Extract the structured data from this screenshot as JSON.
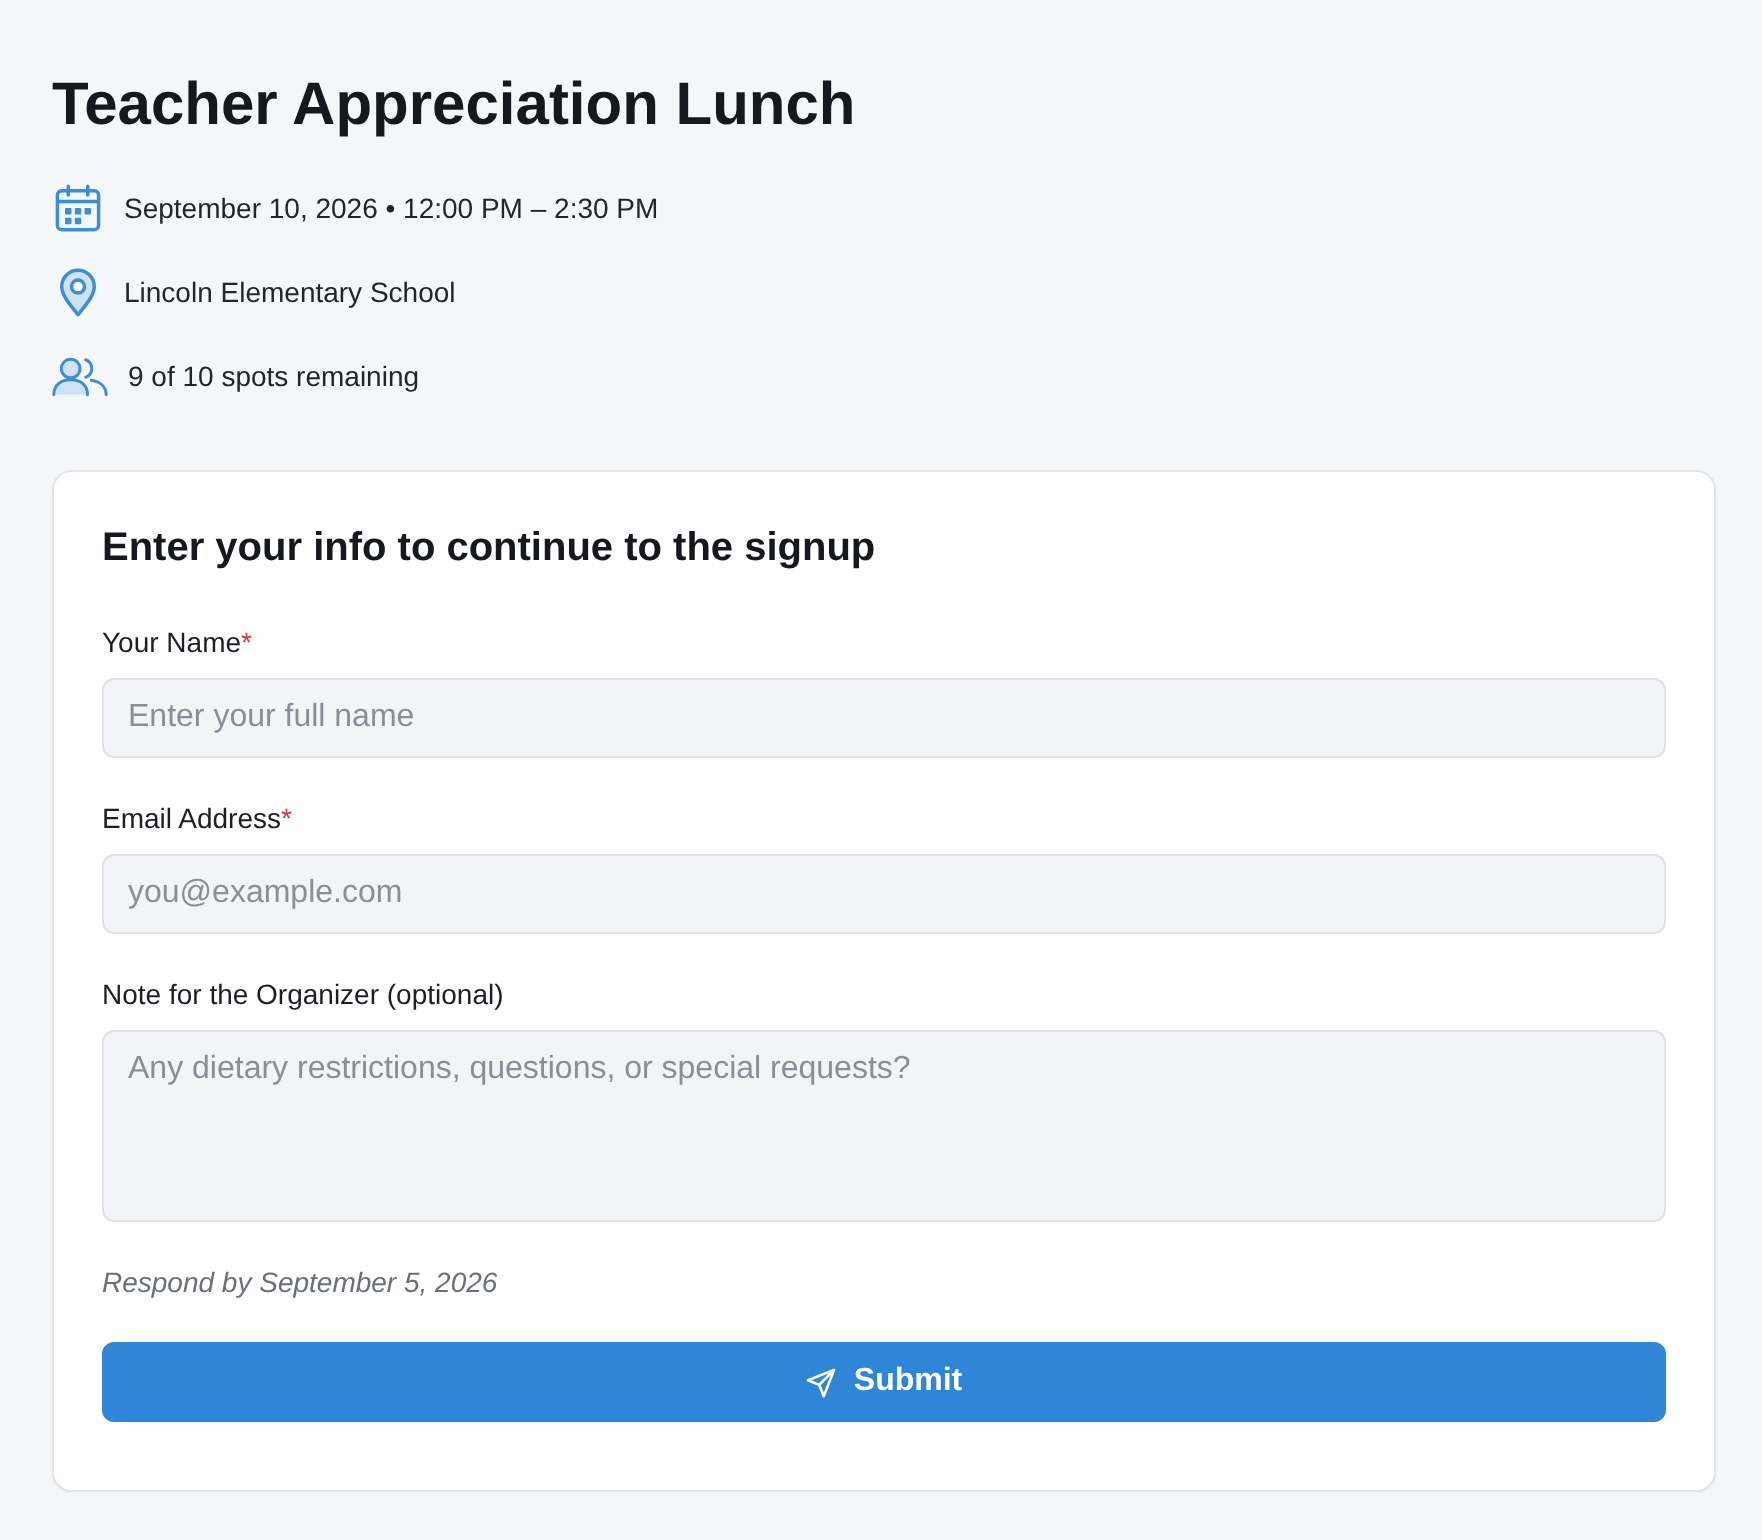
{
  "event": {
    "title": "Teacher Appreciation Lunch",
    "details": [
      {
        "kind": "date",
        "text": "September 10, 2026 • 12:00 PM – 2:30 PM"
      },
      {
        "kind": "location",
        "text": "Lincoln Elementary School"
      },
      {
        "kind": "spots",
        "text": "9 of 10 spots remaining"
      }
    ]
  },
  "form": {
    "title": "Enter your info to continue to the signup",
    "fields": [
      {
        "kind": "input",
        "label": "Your Name",
        "required_mark": "*",
        "placeholder": "Enter your full name"
      },
      {
        "kind": "input",
        "label": "Email Address",
        "required_mark": "*",
        "placeholder": "you@example.com"
      },
      {
        "kind": "textarea",
        "label": "Note for the Organizer (optional)",
        "placeholder": "Any dietary restrictions, questions, or special requests?"
      }
    ],
    "deadline": "Respond by September 5, 2026",
    "submit_button": {
      "label": "Submit"
    }
  }
}
